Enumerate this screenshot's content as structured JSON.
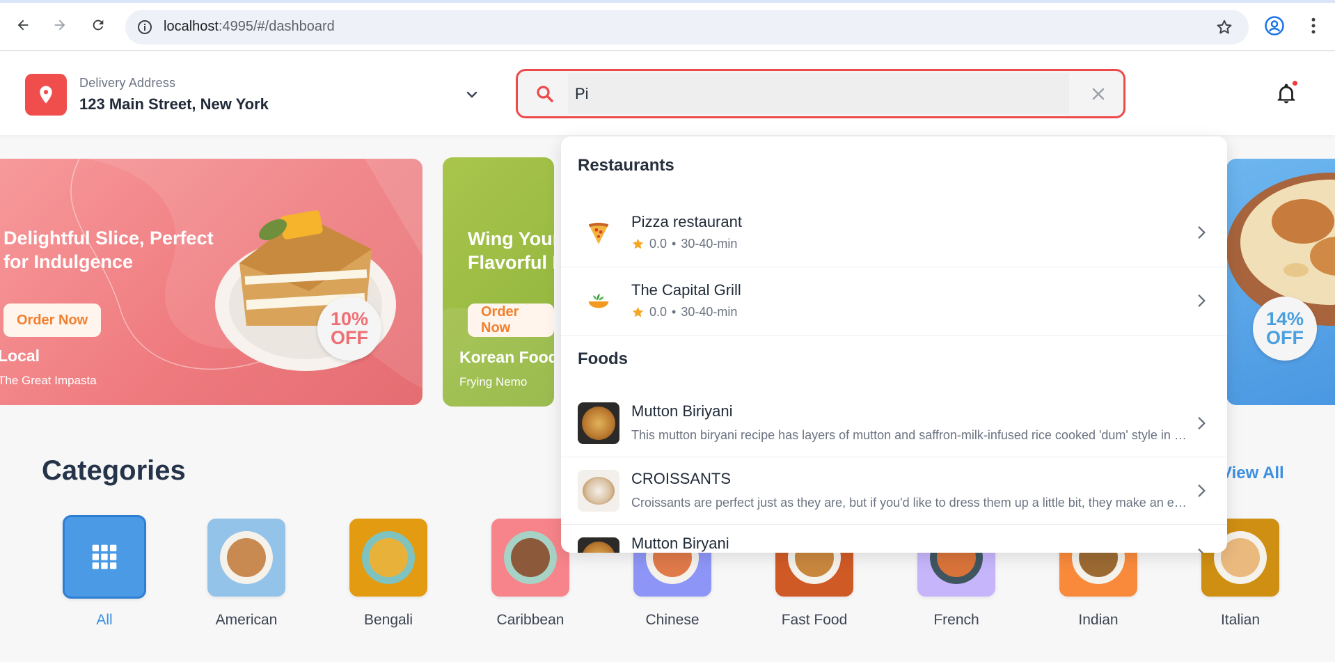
{
  "browser": {
    "url_host": "localhost",
    "url_path": ":4995/#/dashboard"
  },
  "header": {
    "address_label": "Delivery Address",
    "address_value": "123 Main Street, New York",
    "search_value": "Pi",
    "accent_color": "#f04e4c"
  },
  "banners": [
    {
      "headline_1": "Delightful Slice, Perfect",
      "headline_2": "for Indulgence",
      "button": "Order Now",
      "category": "Local",
      "restaurant": "The Great Impasta",
      "discount_num": "10%",
      "discount_word": "OFF",
      "discount_color": "#ee6e73"
    },
    {
      "headline_1": "Wing Your",
      "headline_2": "Flavorful D",
      "button": "Order Now",
      "category": "Korean Food",
      "restaurant": "Frying Nemo"
    },
    {
      "discount_num": "14%",
      "discount_word": "OFF",
      "discount_color": "#4aa0de"
    }
  ],
  "categories": {
    "title": "Categories",
    "view_all": "View All",
    "items": [
      {
        "label": "All"
      },
      {
        "label": "American"
      },
      {
        "label": "Bengali"
      },
      {
        "label": "Caribbean"
      },
      {
        "label": "Chinese"
      },
      {
        "label": "Fast Food"
      },
      {
        "label": "French"
      },
      {
        "label": "Indian"
      },
      {
        "label": "Italian"
      }
    ]
  },
  "dropdown": {
    "restaurants_title": "Restaurants",
    "restaurants": [
      {
        "name": "Pizza restaurant",
        "rating": "0.0",
        "sep": "•",
        "time": "30-40-min"
      },
      {
        "name": "The Capital Grill",
        "rating": "0.0",
        "sep": "•",
        "time": "30-40-min"
      }
    ],
    "foods_title": "Foods",
    "foods": [
      {
        "name": "Mutton Biriyani",
        "desc": "This mutton biryani recipe has layers of mutton and saffron-milk-infused rice cooked 'dum' style in a sealed pot until fragrant and tender."
      },
      {
        "name": "CROISSANTS",
        "desc": "Croissants are perfect just as they are, but if you'd like to dress them up a little bit, they make an excellent base for sandwiches."
      },
      {
        "name": "Mutton Biryani",
        "desc": ""
      }
    ]
  }
}
